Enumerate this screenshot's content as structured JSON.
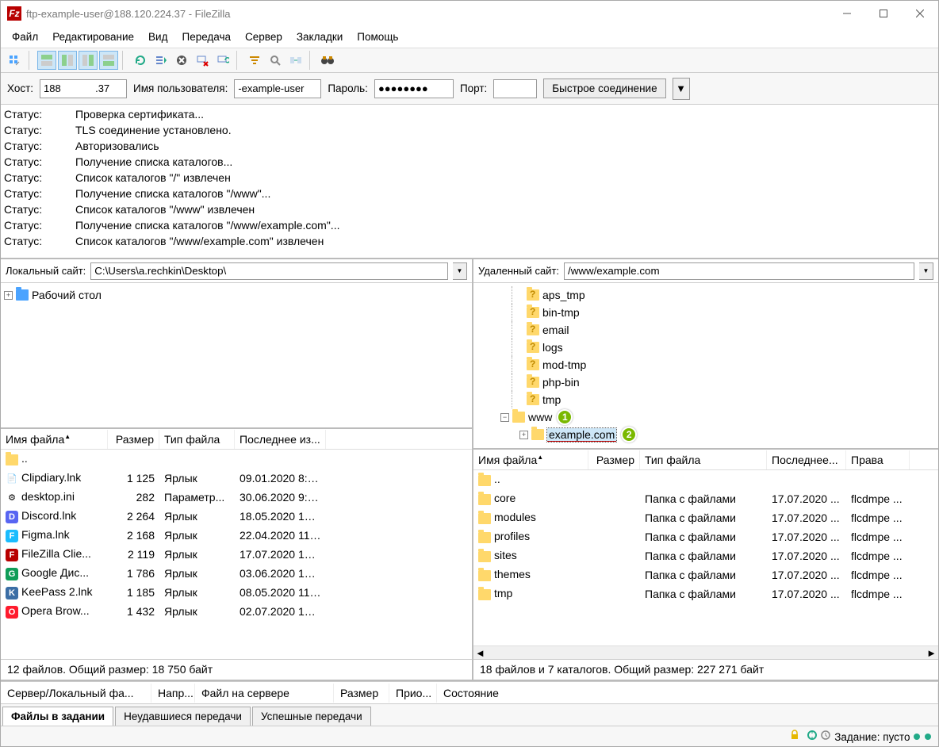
{
  "window": {
    "title": "ftp-example-user@188.120.224.37 - FileZilla"
  },
  "menu": [
    "Файл",
    "Редактирование",
    "Вид",
    "Передача",
    "Сервер",
    "Закладки",
    "Помощь"
  ],
  "quickconnect": {
    "host_label": "Хост:",
    "host_value": "188            .37",
    "user_label": "Имя пользователя:",
    "user_value": "-example-user",
    "pass_label": "Пароль:",
    "pass_value": "●●●●●●●●",
    "port_label": "Порт:",
    "port_value": "",
    "button": "Быстрое соединение"
  },
  "log": {
    "status_label": "Статус:",
    "lines": [
      "Проверка сертификата...",
      "TLS соединение установлено.",
      "Авторизовались",
      "Получение списка каталогов...",
      "Список каталогов \"/\" извлечен",
      "Получение списка каталогов \"/www\"...",
      "Список каталогов \"/www\" извлечен",
      "Получение списка каталогов \"/www/example.com\"...",
      "Список каталогов \"/www/example.com\" извлечен"
    ]
  },
  "local": {
    "path_label": "Локальный сайт:",
    "path_value": "C:\\Users\\a.rechkin\\Desktop\\",
    "tree_root": "Рабочий стол",
    "columns": {
      "name": "Имя файла",
      "size": "Размер",
      "type": "Тип файла",
      "date": "Последнее из..."
    },
    "parent": "..",
    "files": [
      {
        "name": "Clipdiary.lnk",
        "size": "1 125",
        "type": "Ярлык",
        "date": "09.01.2020 8:5...",
        "icon": "link"
      },
      {
        "name": "desktop.ini",
        "size": "282",
        "type": "Параметр...",
        "date": "30.06.2020 9:0...",
        "icon": "ini"
      },
      {
        "name": "Discord.lnk",
        "size": "2 264",
        "type": "Ярлык",
        "date": "18.05.2020 10:...",
        "icon": "discord"
      },
      {
        "name": "Figma.lnk",
        "size": "2 168",
        "type": "Ярлык",
        "date": "22.04.2020 11:...",
        "icon": "figma"
      },
      {
        "name": "FileZilla Clie...",
        "size": "2 119",
        "type": "Ярлык",
        "date": "17.07.2020 15:...",
        "icon": "filezilla"
      },
      {
        "name": "Google Дис...",
        "size": "1 786",
        "type": "Ярлык",
        "date": "03.06.2020 10:...",
        "icon": "gdrive"
      },
      {
        "name": "KeePass 2.lnk",
        "size": "1 185",
        "type": "Ярлык",
        "date": "08.05.2020 11:...",
        "icon": "keepass"
      },
      {
        "name": "Opera Brow...",
        "size": "1 432",
        "type": "Ярлык",
        "date": "02.07.2020 10:...",
        "icon": "opera"
      }
    ],
    "status": "12 файлов. Общий размер: 18 750 байт"
  },
  "remote": {
    "path_label": "Удаленный сайт:",
    "path_value": "/www/example.com",
    "tree": {
      "nodes": [
        "aps_tmp",
        "bin-tmp",
        "email",
        "logs",
        "mod-tmp",
        "php-bin",
        "tmp"
      ],
      "www": "www",
      "www_badge": "1",
      "example": "example.com",
      "example_badge": "2"
    },
    "columns": {
      "name": "Имя файла",
      "size": "Размер",
      "type": "Тип файла",
      "date": "Последнее...",
      "perm": "Права"
    },
    "parent": "..",
    "files": [
      {
        "name": "core",
        "size": "",
        "type": "Папка с файлами",
        "date": "17.07.2020 ...",
        "perm": "flcdmpe ..."
      },
      {
        "name": "modules",
        "size": "",
        "type": "Папка с файлами",
        "date": "17.07.2020 ...",
        "perm": "flcdmpe ..."
      },
      {
        "name": "profiles",
        "size": "",
        "type": "Папка с файлами",
        "date": "17.07.2020 ...",
        "perm": "flcdmpe ..."
      },
      {
        "name": "sites",
        "size": "",
        "type": "Папка с файлами",
        "date": "17.07.2020 ...",
        "perm": "flcdmpe ..."
      },
      {
        "name": "themes",
        "size": "",
        "type": "Папка с файлами",
        "date": "17.07.2020 ...",
        "perm": "flcdmpe ..."
      },
      {
        "name": "tmp",
        "size": "",
        "type": "Папка с файлами",
        "date": "17.07.2020 ...",
        "perm": "flcdmpe ..."
      }
    ],
    "status": "18 файлов и 7 каталогов. Общий размер: 227 271 байт"
  },
  "queue": {
    "columns": [
      "Сервер/Локальный фа...",
      "Напр...",
      "Файл на сервере",
      "Размер",
      "Прио...",
      "Состояние"
    ]
  },
  "tabs": [
    "Файлы в задании",
    "Неудавшиеся передачи",
    "Успешные передачи"
  ],
  "statusbar": {
    "queue": "Задание: пусто"
  },
  "icons": {
    "discord_bg": "#5865F2",
    "figma_bg": "#1abcfe",
    "filezilla_bg": "#b80000",
    "gdrive_bg": "#0f9d58",
    "keepass_bg": "#3b6ea5",
    "opera_bg": "#ff1b2d"
  }
}
